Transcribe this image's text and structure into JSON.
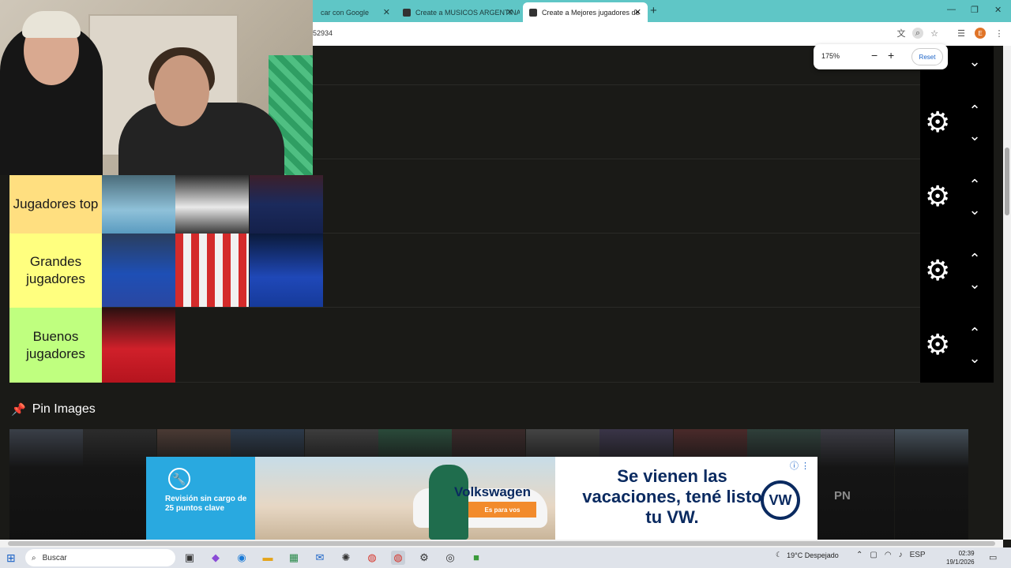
{
  "browser": {
    "tabs": [
      {
        "label": "car con Google",
        "active": false
      },
      {
        "label": "Create a MUSICOS ARGENTINA",
        "active": false
      },
      {
        "label": "Create a Mejores jugadores de",
        "active": true
      }
    ],
    "new_tab": "+",
    "url": "52934",
    "zoom": {
      "level": "175%",
      "minus": "−",
      "plus": "+",
      "reset": "Reset"
    },
    "profile_initial": "E",
    "window_controls": {
      "minimize": "—",
      "restore": "❐",
      "close": "✕"
    }
  },
  "tiers": [
    {
      "label": "",
      "color": "#1a1a17",
      "images": [
        "player"
      ]
    },
    {
      "label": "",
      "color": "#1a1a17",
      "images": []
    },
    {
      "label": "Jugadores top",
      "color": "#ffdf80",
      "images": [
        "player-sky-blue",
        "player-white-kit",
        "player-psg"
      ]
    },
    {
      "label": "Grandes jugadores",
      "color": "#ffff7f",
      "images": [
        "player-goalkeeper",
        "player-red-white",
        "player-chelsea"
      ]
    },
    {
      "label": "Buenos jugadores",
      "color": "#bfff7f",
      "images": [
        "player-bayern"
      ]
    }
  ],
  "controls": {
    "gear": "⚙",
    "up": "⌃",
    "down": "⌄"
  },
  "pin_images": {
    "title": "Pin Images",
    "icon": "pin-icon",
    "count": 13
  },
  "ad": {
    "service_text": "Revisión sin cargo de 25 puntos clave",
    "brand": "Volkswagen",
    "cta": "Es para vos",
    "headline": "Se vienen las vacaciones, tené listo tu VW.",
    "logo": "VW",
    "side_text": "PN"
  },
  "taskbar": {
    "search_placeholder": "Buscar",
    "weather": "19°C Despejado",
    "language": "ESP",
    "time": "02:39",
    "date": "19/1/2026"
  },
  "colors": {
    "accent_teal": "#5fc6c6",
    "page_bg": "#1a1a17",
    "ad_blue": "#29a9e0",
    "vw_navy": "#0a2a60"
  }
}
